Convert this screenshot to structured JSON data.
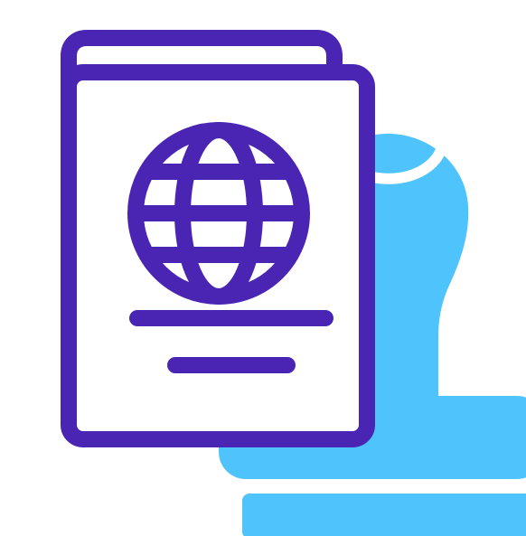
{
  "illustration": {
    "icons": [
      "passport-icon",
      "globe-icon",
      "rubber-stamp-icon"
    ],
    "colors": {
      "passport_outline": "#4A25B3",
      "stamp_fill": "#4FC3FB",
      "background": "#FFFFFF"
    }
  }
}
